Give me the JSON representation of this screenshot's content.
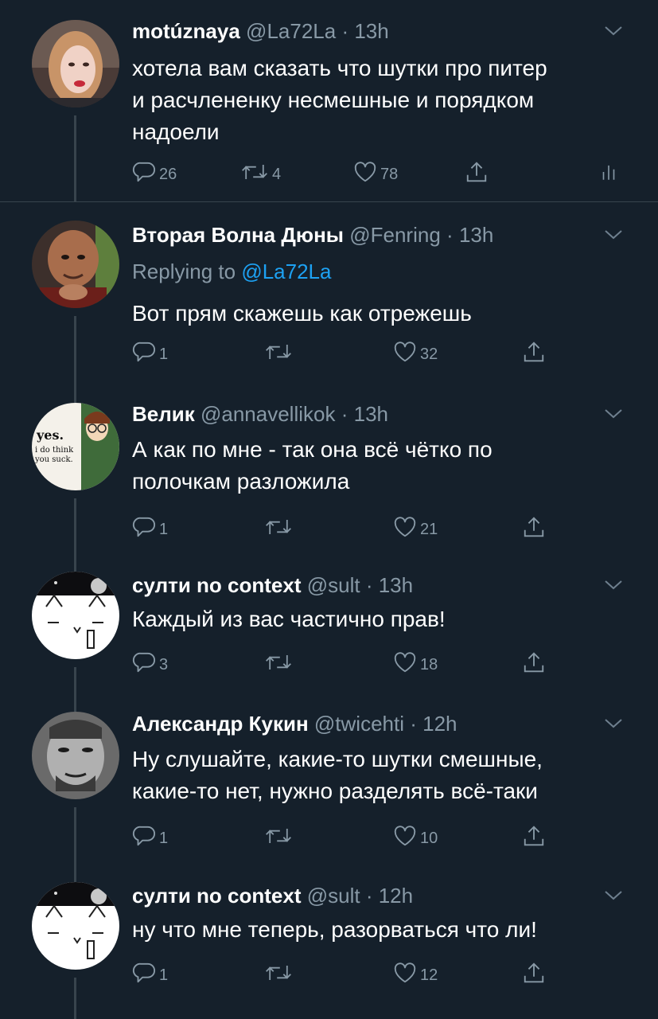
{
  "tweets": [
    {
      "name": "motúznaya",
      "handle": "@La72La",
      "time": "13h",
      "lines": [
        "хотела вам сказать что шутки про питер",
        "и расчлененку несмешные и порядком",
        "надоели"
      ],
      "replies": "26",
      "retweets": "4",
      "likes": "78"
    },
    {
      "name": "Вторая Волна Дюны",
      "handle": "@Fenring",
      "time": "13h",
      "replying_label": "Replying to",
      "replying_mention": "@La72La",
      "lines": [
        "Вот прям скажешь как отрежешь"
      ],
      "replies": "1",
      "likes": "32"
    },
    {
      "name": "Велик",
      "handle": "@annavellikok",
      "time": "13h",
      "lines": [
        "А как по мне - так она всё чётко по",
        "полочкам разложила"
      ],
      "replies": "1",
      "likes": "21",
      "avatar_text": [
        "yes.",
        "i do think",
        "you suck."
      ]
    },
    {
      "name": "султи no context",
      "handle": "@sult",
      "time": "13h",
      "lines": [
        "Каждый из вас частично прав!"
      ],
      "replies": "3",
      "likes": "18"
    },
    {
      "name": "Александр Кукин",
      "handle": "@twicehti",
      "time": "12h",
      "lines": [
        "Ну слушайте, какие-то шутки смешные,",
        "какие-то нет, нужно разделять всё-таки"
      ],
      "replies": "1",
      "likes": "10"
    },
    {
      "name": "султи no context",
      "handle": "@sult",
      "time": "12h",
      "lines": [
        "ну что мне теперь, разорваться что ли!"
      ],
      "replies": "1",
      "likes": "12"
    }
  ],
  "separator": "·",
  "colors": {
    "background": "#15202b",
    "secondary_text": "#8899a6",
    "link": "#1da1f2",
    "border": "#38444d"
  },
  "icons": {
    "reply": "reply-icon",
    "retweet": "retweet-icon",
    "like": "heart-icon",
    "share": "share-icon",
    "analytics": "analytics-icon",
    "menu": "chevron-down-icon"
  }
}
